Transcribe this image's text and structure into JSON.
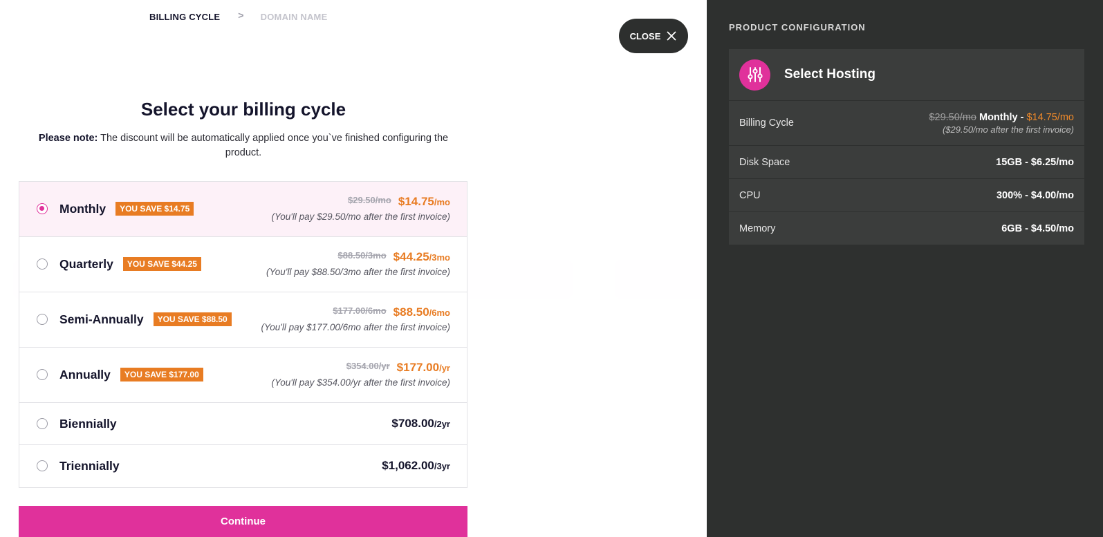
{
  "stepper": {
    "active": "BILLING CYCLE",
    "separator": ">",
    "inactive": "DOMAIN NAME"
  },
  "close_label": "CLOSE",
  "title": "Select your billing cycle",
  "note": {
    "bold": "Please note:",
    "text": " The discount will be automatically applied once you`ve finished configuring the product."
  },
  "options": [
    {
      "name": "Monthly",
      "badge": "YOU SAVE $14.75",
      "old": "$29.50/mo",
      "price": "$14.75",
      "unit": "/mo",
      "after": "(You'll pay $29.50/mo after the first invoice)",
      "selected": true
    },
    {
      "name": "Quarterly",
      "badge": "YOU SAVE $44.25",
      "old": "$88.50/3mo",
      "price": "$44.25",
      "unit": "/3mo",
      "after": "(You'll pay $88.50/3mo after the first invoice)",
      "selected": false
    },
    {
      "name": "Semi-Annually",
      "badge": "YOU SAVE $88.50",
      "old": "$177.00/6mo",
      "price": "$88.50",
      "unit": "/6mo",
      "after": "(You'll pay $177.00/6mo after the first invoice)",
      "selected": false
    },
    {
      "name": "Annually",
      "badge": "YOU SAVE $177.00",
      "old": "$354.00/yr",
      "price": "$177.00",
      "unit": "/yr",
      "after": "(You'll pay $354.00/yr after the first invoice)",
      "selected": false
    },
    {
      "name": "Biennially",
      "price": "$708.00",
      "unit": "/2yr",
      "selected": false
    },
    {
      "name": "Triennially",
      "price": "$1,062.00",
      "unit": "/3yr",
      "selected": false
    }
  ],
  "continue_label": "Continue",
  "panel": {
    "title": "PRODUCT CONFIGURATION",
    "product": "Select Hosting",
    "icon": "sliders-icon",
    "billing": {
      "label": "Billing Cycle",
      "old": "$29.50/mo",
      "cycle": "Monthly - ",
      "price": "$14.75/mo",
      "after": "($29.50/mo after the first invoice)"
    },
    "rows": [
      {
        "label": "Disk Space",
        "value": "15GB - $6.25/mo"
      },
      {
        "label": "CPU",
        "value": "300% - $4.00/mo"
      },
      {
        "label": "Memory",
        "value": "6GB - $4.50/mo"
      }
    ]
  },
  "colors": {
    "accent": "#e0319b",
    "save_badge": "#e87c23",
    "panel_bg": "#2e302f"
  }
}
